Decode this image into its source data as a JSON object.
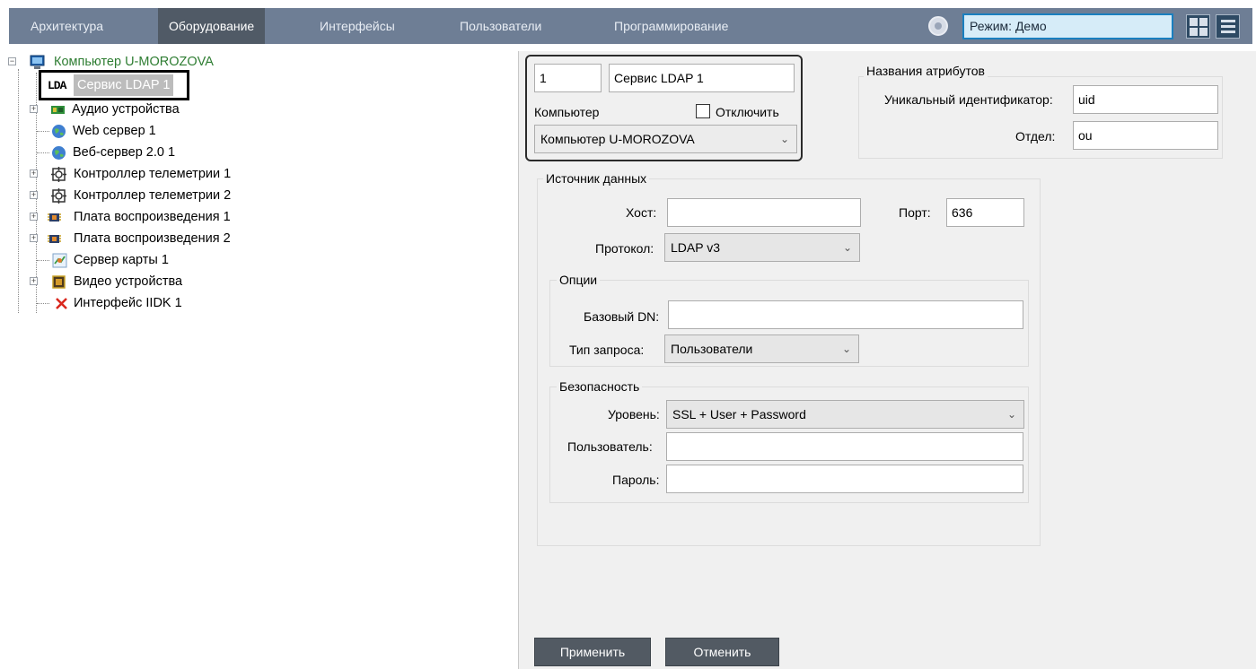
{
  "top_tabs": [
    {
      "label": "Архитектура",
      "active": false
    },
    {
      "label": "Оборудование",
      "active": true
    },
    {
      "label": "Интерфейсы",
      "active": false
    },
    {
      "label": "Пользователи",
      "active": false
    },
    {
      "label": "Программирование",
      "active": false
    }
  ],
  "mode": {
    "label": "Режим: Демо",
    "icon": "gear-icon"
  },
  "colors": {
    "tab_strip": "#6e7e95",
    "active_tab": "#505a66",
    "mode_border": "#1a7fbf",
    "highlight": "#000000"
  },
  "tree": {
    "root": {
      "label": "Компьютер U-MOROZOVA",
      "icon": "computer-icon"
    },
    "items": [
      {
        "label": "Сервис LDAP 1",
        "icon": "ldap-icon",
        "selected": true
      },
      {
        "label": "Аудио устройства",
        "icon": "audio-board-icon"
      },
      {
        "label": "Web сервер 1",
        "icon": "globe-icon"
      },
      {
        "label": "Веб-сервер 2.0 1",
        "icon": "globe-icon"
      },
      {
        "label": "Контроллер телеметрии 1",
        "icon": "telemetry-icon"
      },
      {
        "label": "Контроллер телеметрии 2",
        "icon": "telemetry-icon"
      },
      {
        "label": "Плата воспроизведения 1",
        "icon": "playback-board-icon"
      },
      {
        "label": "Плата воспроизведения 2",
        "icon": "playback-board-icon"
      },
      {
        "label": "Сервер карты 1",
        "icon": "map-server-icon"
      },
      {
        "label": "Видео устройства",
        "icon": "video-board-icon"
      },
      {
        "label": "Интерфейс IIDK 1",
        "icon": "cross-icon"
      }
    ]
  },
  "ldap_icon_text": "LDA",
  "object": {
    "id": "1",
    "name": "Сервис LDAP 1",
    "computer_label": "Компьютер",
    "disable_label": "Отключить",
    "disable_checked": false,
    "computer_value": "Компьютер U-MOROZOVA"
  },
  "attributes": {
    "title": "Названия атрибутов",
    "uid_label": "Уникальный идентификатор:",
    "uid_value": "uid",
    "dept_label": "Отдел:",
    "dept_value": "ou"
  },
  "source": {
    "title": "Источник данных",
    "host_label": "Хост:",
    "host_value": "",
    "port_label": "Порт:",
    "port_value": "636",
    "protocol_label": "Протокол:",
    "protocol_value": "LDAP v3"
  },
  "options": {
    "title": "Опции",
    "base_dn_label": "Базовый DN:",
    "base_dn_value": "",
    "query_label": "Тип запроса:",
    "query_value": "Пользователи"
  },
  "security": {
    "title": "Безопасность",
    "level_label": "Уровень:",
    "level_value": "SSL + User + Password",
    "user_label": "Пользователь:",
    "user_value": "",
    "password_label": "Пароль:",
    "password_value": ""
  },
  "buttons": {
    "apply": "Применить",
    "cancel": "Отменить"
  }
}
